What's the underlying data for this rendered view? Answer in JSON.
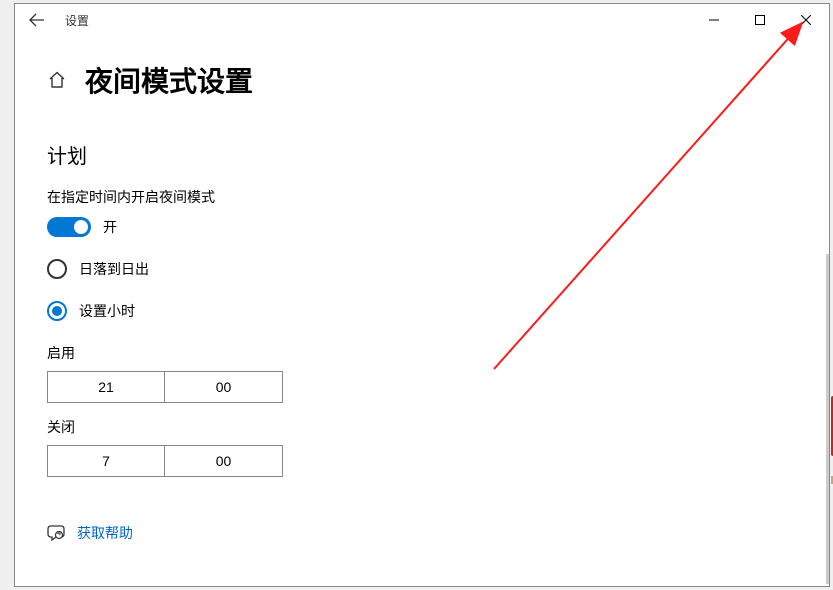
{
  "titlebar": {
    "app_title": "设置"
  },
  "page": {
    "title": "夜间模式设置"
  },
  "schedule": {
    "section_title": "计划",
    "enable_label": "在指定时间内开启夜间模式",
    "toggle_state": "开",
    "radio_sunset": "日落到日出",
    "radio_hours": "设置小时",
    "turn_on_label": "启用",
    "turn_on_hour": "21",
    "turn_on_minute": "00",
    "turn_off_label": "关闭",
    "turn_off_hour": "7",
    "turn_off_minute": "00"
  },
  "help": {
    "link": "获取帮助"
  }
}
